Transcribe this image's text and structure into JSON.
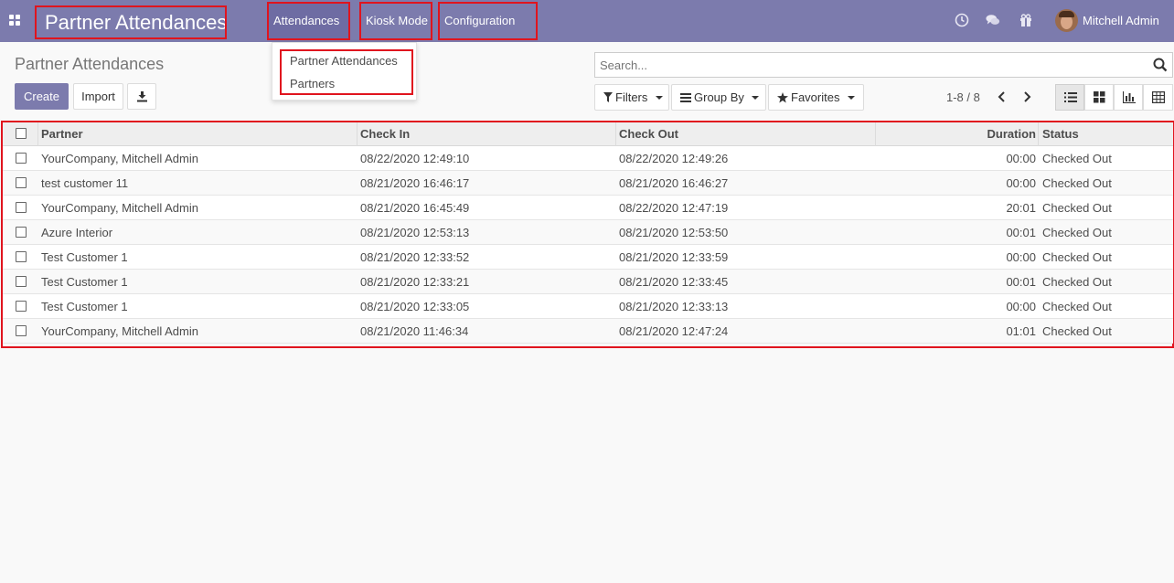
{
  "navbar": {
    "app_title": "Partner Attendances",
    "menus": [
      "Attendances",
      "Kiosk Mode",
      "Configuration"
    ],
    "user_name": "Mitchell Admin",
    "icons": [
      "apps-icon",
      "clock-icon",
      "chat-icon",
      "gift-icon"
    ]
  },
  "dropdown": {
    "items": [
      "Partner Attendances",
      "Partners"
    ]
  },
  "control_panel": {
    "page_title": "Partner Attendances",
    "create_label": "Create",
    "import_label": "Import",
    "search_placeholder": "Search...",
    "filters_label": "Filters",
    "groupby_label": "Group By",
    "favorites_label": "Favorites",
    "pager": "1-8 / 8"
  },
  "table": {
    "columns": [
      "Partner",
      "Check In",
      "Check Out",
      "Duration",
      "Status"
    ],
    "rows": [
      {
        "partner": "YourCompany, Mitchell Admin",
        "check_in": "08/22/2020 12:49:10",
        "check_out": "08/22/2020 12:49:26",
        "duration": "00:00",
        "status": "Checked Out"
      },
      {
        "partner": "test customer 11",
        "check_in": "08/21/2020 16:46:17",
        "check_out": "08/21/2020 16:46:27",
        "duration": "00:00",
        "status": "Checked Out"
      },
      {
        "partner": "YourCompany, Mitchell Admin",
        "check_in": "08/21/2020 16:45:49",
        "check_out": "08/22/2020 12:47:19",
        "duration": "20:01",
        "status": "Checked Out"
      },
      {
        "partner": "Azure Interior",
        "check_in": "08/21/2020 12:53:13",
        "check_out": "08/21/2020 12:53:50",
        "duration": "00:01",
        "status": "Checked Out"
      },
      {
        "partner": "Test Customer 1",
        "check_in": "08/21/2020 12:33:52",
        "check_out": "08/21/2020 12:33:59",
        "duration": "00:00",
        "status": "Checked Out"
      },
      {
        "partner": "Test Customer 1",
        "check_in": "08/21/2020 12:33:21",
        "check_out": "08/21/2020 12:33:45",
        "duration": "00:01",
        "status": "Checked Out"
      },
      {
        "partner": "Test Customer 1",
        "check_in": "08/21/2020 12:33:05",
        "check_out": "08/21/2020 12:33:13",
        "duration": "00:00",
        "status": "Checked Out"
      },
      {
        "partner": "YourCompany, Mitchell Admin",
        "check_in": "08/21/2020 11:46:34",
        "check_out": "08/21/2020 12:47:24",
        "duration": "01:01",
        "status": "Checked Out"
      }
    ]
  },
  "colors": {
    "navbar": "#7c7bad",
    "highlight": "#e0141e"
  }
}
